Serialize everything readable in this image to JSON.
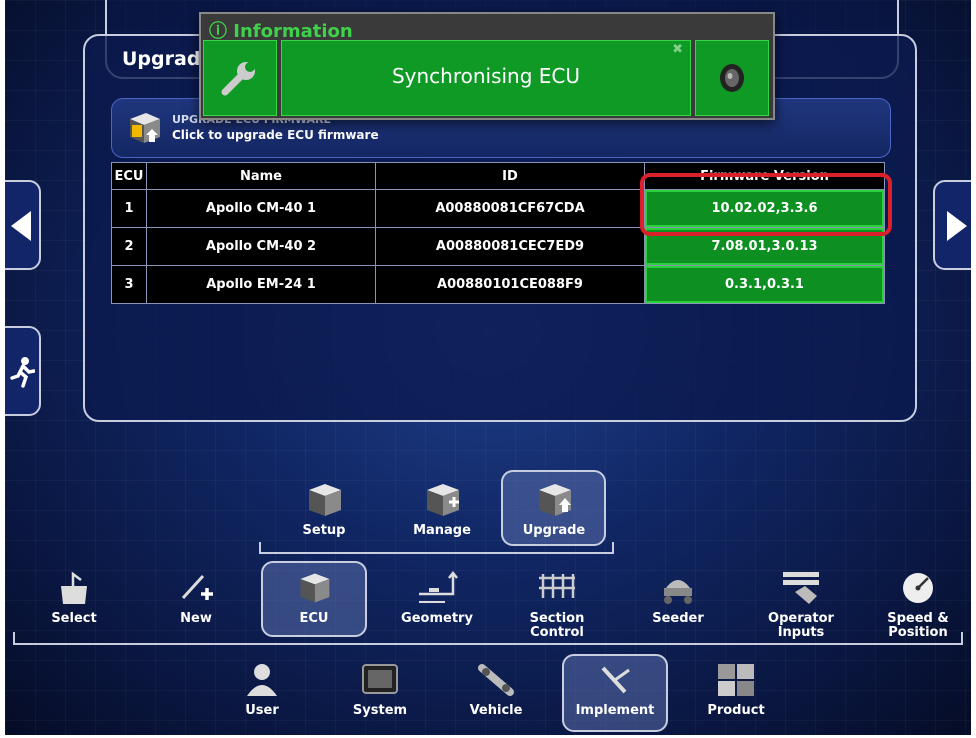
{
  "overlay": {
    "title": "Information",
    "message": "Synchronising ECU",
    "close_glyph": "✖"
  },
  "panel": {
    "title": "Upgrade"
  },
  "firmware_bar": {
    "title": "UPGRADE ECU FIRMWARE",
    "subtitle": "Click to upgrade ECU firmware"
  },
  "table": {
    "headers": [
      "ECU",
      "Name",
      "ID",
      "Firmware Version"
    ],
    "rows": [
      [
        "1",
        "Apollo CM-40 1",
        "A00880081CF67CDA",
        "10.02.02,3.3.6"
      ],
      [
        "2",
        "Apollo CM-40 2",
        "A00880081CEC7ED9",
        "7.08.01,3.0.13"
      ],
      [
        "3",
        "Apollo EM-24 1",
        "A00880101CE088F9",
        "0.3.1,0.3.1"
      ]
    ]
  },
  "submenu": {
    "items": [
      {
        "label": "Setup"
      },
      {
        "label": "Manage"
      },
      {
        "label": "Upgrade"
      }
    ],
    "selected": "Upgrade"
  },
  "implement_menu": {
    "items": [
      {
        "label": "Select"
      },
      {
        "label": "New"
      },
      {
        "label": "ECU"
      },
      {
        "label": "Geometry"
      },
      {
        "label": "Section Control"
      },
      {
        "label": "Seeder"
      },
      {
        "label": "Operator Inputs"
      },
      {
        "label": "Speed & Position"
      }
    ],
    "selected": "ECU"
  },
  "main_menu": {
    "items": [
      {
        "label": "User"
      },
      {
        "label": "System"
      },
      {
        "label": "Vehicle"
      },
      {
        "label": "Implement"
      },
      {
        "label": "Product"
      }
    ],
    "selected": "Implement"
  },
  "colors": {
    "background": "#0e2260",
    "status_green": "#0f9a26",
    "highlight_red": "#d9202b",
    "panel_border": "#c8cde0"
  },
  "icons": [
    "info-icon",
    "wrench-icon",
    "speaker-icon",
    "ecu-upgrade-icon",
    "left-arrow-icon",
    "right-arrow-icon",
    "exit-icon"
  ]
}
